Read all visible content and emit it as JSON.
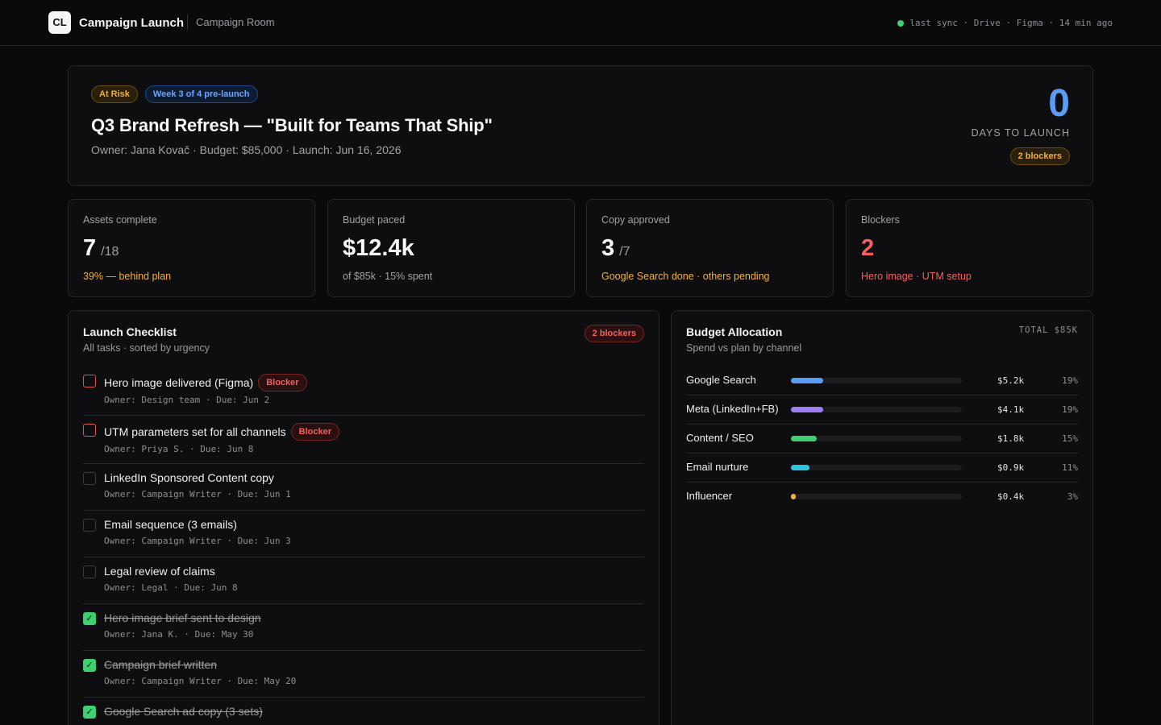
{
  "topbar": {
    "logo": "CL",
    "app_title": "Campaign Launch",
    "room": "Campaign Room",
    "sync_text": "last sync · Drive · Figma · 14 min ago"
  },
  "hero": {
    "status_badge": "At Risk",
    "week_badge": "Week 3 of 4 pre-launch",
    "title": "Q3 Brand Refresh — \"Built for Teams That Ship\"",
    "meta": "Owner: Jana Kovač · Budget: $85,000 · Launch: Jun 16, 2026",
    "days_value": "0",
    "days_label": "DAYS TO LAUNCH",
    "blockers_badge": "2 blockers"
  },
  "stats": [
    {
      "label": "Assets complete",
      "value": "7",
      "of": "/18",
      "sub": "39% — behind plan",
      "sub_color": "#f1b03d",
      "value_color": "#f7f7f8"
    },
    {
      "label": "Budget paced",
      "value": "$12.4k",
      "of": "",
      "sub": "of $85k · 15% spent",
      "sub_color": "#a1a1a8",
      "value_color": "#f7f7f8"
    },
    {
      "label": "Copy approved",
      "value": "3",
      "of": "/7",
      "sub": "Google Search done · others pending",
      "sub_color": "#f1b03d",
      "value_color": "#f7f7f8"
    },
    {
      "label": "Blockers",
      "value": "2",
      "of": "",
      "sub": "Hero image · UTM setup",
      "sub_color": "#f2605f",
      "value_color": "#f2605f"
    }
  ],
  "checklist": {
    "title": "Launch Checklist",
    "subtitle": "All tasks · sorted by urgency",
    "badge": "2 blockers",
    "blocker_label": "Blocker",
    "tasks": [
      {
        "title": "Hero image delivered (Figma)",
        "meta": "Owner: Design team · Due: Jun 2",
        "state": "blocker"
      },
      {
        "title": "UTM parameters set for all channels",
        "meta": "Owner: Priya S. · Due: Jun 8",
        "state": "blocker"
      },
      {
        "title": "LinkedIn Sponsored Content copy",
        "meta": "Owner: Campaign Writer · Due: Jun 1",
        "state": "open"
      },
      {
        "title": "Email sequence (3 emails)",
        "meta": "Owner: Campaign Writer · Due: Jun 3",
        "state": "open"
      },
      {
        "title": "Legal review of claims",
        "meta": "Owner: Legal · Due: Jun 8",
        "state": "open"
      },
      {
        "title": "Hero image brief sent to design",
        "meta": "Owner: Jana K. · Due: May 30",
        "state": "done"
      },
      {
        "title": "Campaign brief written",
        "meta": "Owner: Campaign Writer · Due: May 20",
        "state": "done"
      },
      {
        "title": "Google Search ad copy (3 sets)",
        "meta": "",
        "state": "done"
      }
    ]
  },
  "budget": {
    "title": "Budget Allocation",
    "subtitle": "Spend vs plan by channel",
    "total": "TOTAL $85K",
    "channels": [
      {
        "name": "Google Search",
        "amount": "$5.2k",
        "pct": "19%",
        "fill": 0.19,
        "color": "#5b9cf4"
      },
      {
        "name": "Meta (LinkedIn+FB)",
        "amount": "$4.1k",
        "pct": "19%",
        "fill": 0.19,
        "color": "#a07ef5"
      },
      {
        "name": "Content / SEO",
        "amount": "$1.8k",
        "pct": "15%",
        "fill": 0.15,
        "color": "#3ecf6e"
      },
      {
        "name": "Email nurture",
        "amount": "$0.9k",
        "pct": "11%",
        "fill": 0.11,
        "color": "#2ec6de"
      },
      {
        "name": "Influencer",
        "amount": "$0.4k",
        "pct": "3%",
        "fill": 0.03,
        "color": "#f1b03d"
      }
    ]
  }
}
